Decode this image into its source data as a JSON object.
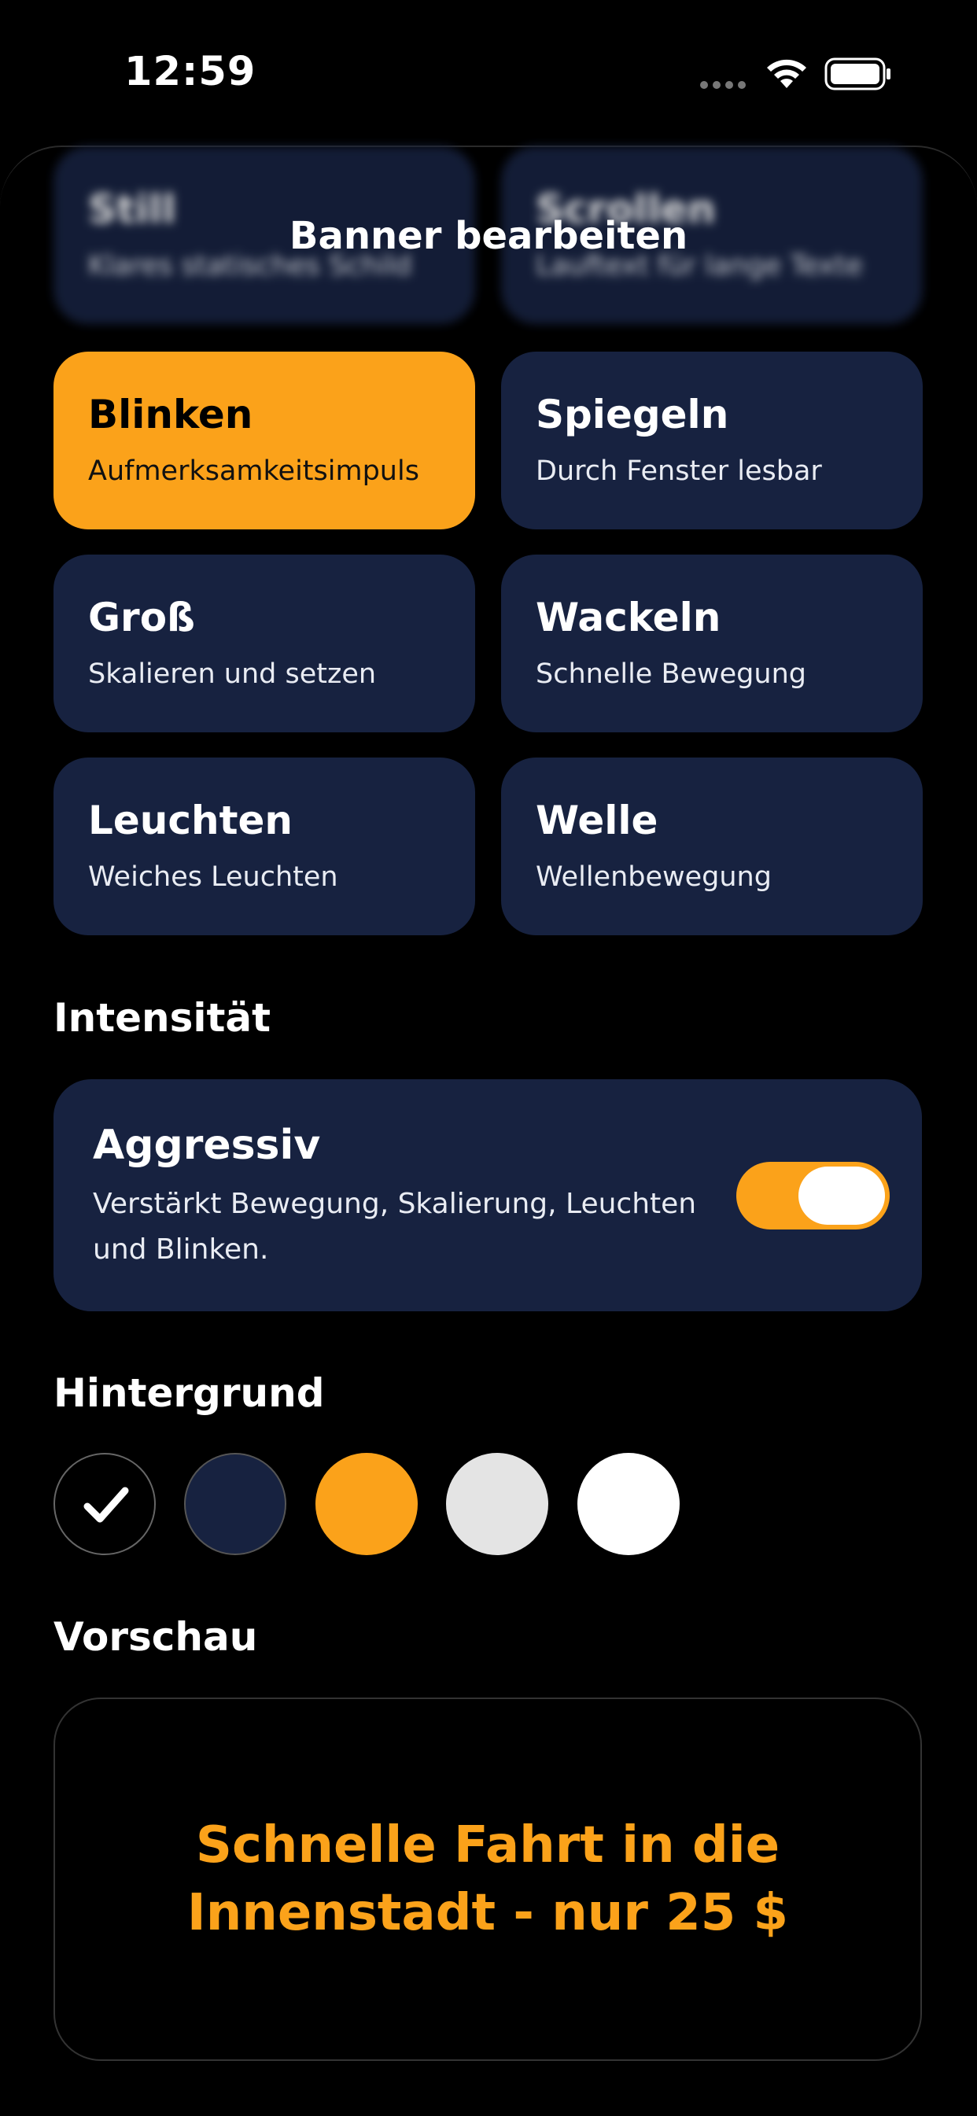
{
  "status_bar": {
    "time": "12:59"
  },
  "sheet": {
    "title": "Banner bearbeiten"
  },
  "styles": [
    {
      "title": "Still",
      "subtitle": "Klares statisches Schild"
    },
    {
      "title": "Scrollen",
      "subtitle": "Lauftext für lange Texte"
    },
    {
      "title": "Blinken",
      "subtitle": "Aufmerksamkeitsimpuls",
      "selected": true
    },
    {
      "title": "Spiegeln",
      "subtitle": "Durch Fenster lesbar"
    },
    {
      "title": "Groß",
      "subtitle": "Skalieren und setzen"
    },
    {
      "title": "Wackeln",
      "subtitle": "Schnelle Bewegung"
    },
    {
      "title": "Leuchten",
      "subtitle": "Weiches Leuchten"
    },
    {
      "title": "Welle",
      "subtitle": "Wellenbewegung"
    }
  ],
  "intensity": {
    "heading": "Intensität",
    "title": "Aggressiv",
    "subtitle": "Verstärkt Bewegung, Skalierung, Leuchten und Blinken.",
    "toggle_on": true
  },
  "background": {
    "heading": "Hintergrund",
    "swatches": [
      {
        "color": "#000000",
        "selected": true,
        "icon": "checkmark-icon"
      },
      {
        "color": "#172240"
      },
      {
        "color": "#FBA21A"
      },
      {
        "color": "#E4E4E4"
      },
      {
        "color": "#FFFFFF"
      }
    ]
  },
  "preview": {
    "heading": "Vorschau",
    "text": "Schnelle Fahrt in die Innenstadt - nur 25 $"
  },
  "colors": {
    "accent": "#FBA21A",
    "card": "#172240"
  }
}
